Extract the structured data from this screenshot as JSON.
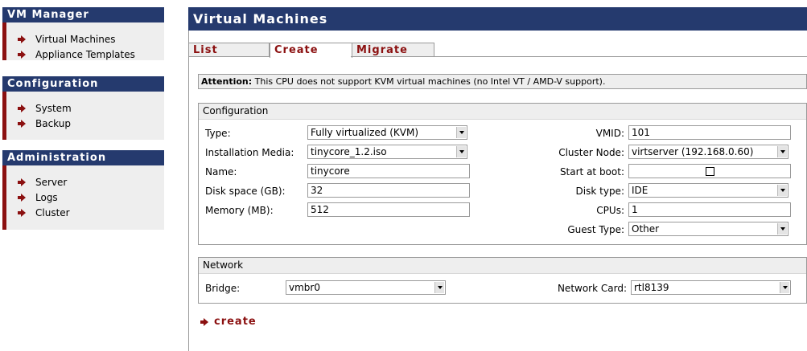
{
  "sidebar": {
    "sections": [
      {
        "title": "VM Manager",
        "items": [
          "Virtual Machines",
          "Appliance Templates"
        ]
      },
      {
        "title": "Configuration",
        "items": [
          "System",
          "Backup"
        ]
      },
      {
        "title": "Administration",
        "items": [
          "Server",
          "Logs",
          "Cluster"
        ]
      }
    ]
  },
  "header": {
    "title": "Virtual Machines"
  },
  "tabs": [
    {
      "label": "List",
      "active": false
    },
    {
      "label": "Create",
      "active": true
    },
    {
      "label": "Migrate",
      "active": false
    }
  ],
  "attention": {
    "label": "Attention:",
    "text": "This CPU does not support KVM virtual machines (no Intel VT / AMD-V support)."
  },
  "configuration": {
    "title": "Configuration",
    "type": {
      "label": "Type:",
      "value": "Fully virtualized (KVM)"
    },
    "media": {
      "label": "Installation Media:",
      "value": "tinycore_1.2.iso"
    },
    "name": {
      "label": "Name:",
      "value": "tinycore"
    },
    "disk_space": {
      "label": "Disk space (GB):",
      "value": "32"
    },
    "memory": {
      "label": "Memory (MB):",
      "value": "512"
    },
    "vmid": {
      "label": "VMID:",
      "value": "101"
    },
    "cluster_node": {
      "label": "Cluster Node:",
      "value": "virtserver (192.168.0.60)"
    },
    "start_at_boot": {
      "label": "Start at boot:",
      "checked": false
    },
    "disk_type": {
      "label": "Disk type:",
      "value": "IDE"
    },
    "cpus": {
      "label": "CPUs:",
      "value": "1"
    },
    "guest_type": {
      "label": "Guest Type:",
      "value": "Other"
    }
  },
  "network": {
    "title": "Network",
    "bridge": {
      "label": "Bridge:",
      "value": "vmbr0"
    },
    "card": {
      "label": "Network Card:",
      "value": "rtl8139"
    }
  },
  "actions": {
    "create_label": "create"
  },
  "colors": {
    "header_bg": "#253a6e",
    "accent": "#8b1010",
    "panel_bg": "#eeeeee"
  },
  "icons": {
    "bullet": "arrow-right-icon"
  }
}
